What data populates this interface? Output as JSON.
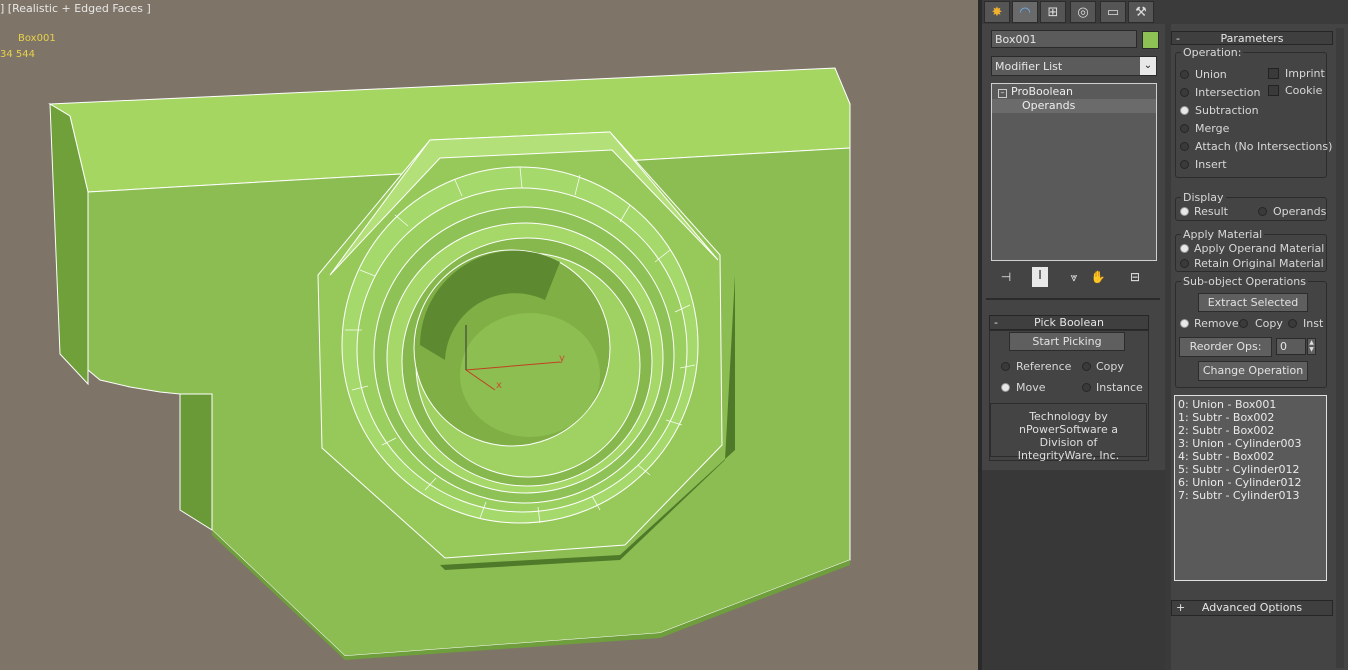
{
  "viewport": {
    "label": "] [Realistic + Edged Faces ]",
    "object_name": "Box001",
    "counts": "34  544",
    "model_color": "#8fbf4a",
    "axis_x": "x",
    "axis_y": "y"
  },
  "command_tabs": [
    "create-icon",
    "modify-icon",
    "hierarchy-icon",
    "motion-icon",
    "display-icon",
    "utilities-icon"
  ],
  "object": {
    "name": "Box001",
    "color": "#8dc055"
  },
  "modifier_list": {
    "label": "Modifier List"
  },
  "stack": {
    "modifier": "ProBoolean",
    "sub": "Operands"
  },
  "parameters": {
    "header": "Parameters",
    "operation_title": "Operation:",
    "ops": [
      "Union",
      "Intersection",
      "Subtraction",
      "Merge",
      "Attach (No Intersections)",
      "Insert"
    ],
    "selected_op": "Subtraction",
    "imprint": "Imprint",
    "cookie": "Cookie",
    "display_title": "Display",
    "display_result": "Result",
    "display_operands": "Operands",
    "apply_material_title": "Apply Material",
    "apply_operand": "Apply Operand Material",
    "retain_original": "Retain Original Material",
    "subobject_title": "Sub-object Operations",
    "extract_selected": "Extract Selected",
    "remove": "Remove",
    "copy": "Copy",
    "inst": "Inst",
    "reorder_ops": "Reorder Ops:",
    "reorder_value": "0",
    "change_operation": "Change Operation",
    "operands_list": [
      "0: Union - Box001",
      "1: Subtr - Box002",
      "2: Subtr - Box002",
      "3: Union - Cylinder003",
      "4: Subtr - Box002",
      "5: Subtr - Cylinder012",
      "6: Union - Cylinder012",
      "7: Subtr - Cylinder013"
    ],
    "advanced_options": "Advanced Options"
  },
  "pick_boolean": {
    "header": "Pick Boolean",
    "start_picking": "Start Picking",
    "reference": "Reference",
    "copy": "Copy",
    "move": "Move",
    "instance": "Instance",
    "credit": "Technology by nPowerSoftware a Division of IntegrityWare, Inc."
  }
}
